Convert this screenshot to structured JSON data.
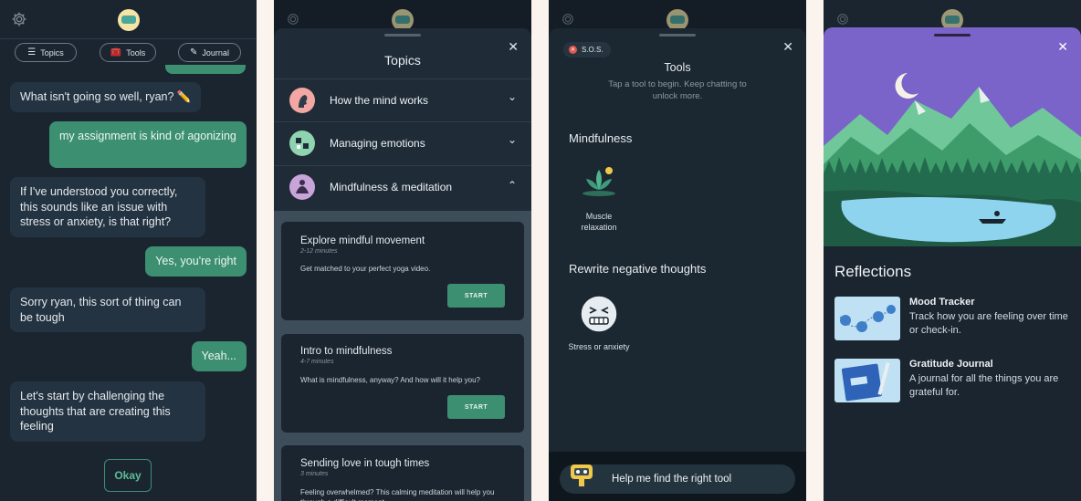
{
  "screen1": {
    "chips": [
      {
        "icon": "list-icon",
        "label": "Topics"
      },
      {
        "icon": "toolbox-icon",
        "label": "Tools"
      },
      {
        "icon": "journal-icon",
        "label": "Journal"
      }
    ],
    "messages": [
      {
        "from": "bot",
        "text": "What isn't going so well, ryan? ✏️"
      },
      {
        "from": "user",
        "text": "my assignment is kind of agonizing"
      },
      {
        "from": "bot",
        "text": "If I've understood you correctly, this sounds like an issue with stress or anxiety, is that right?"
      },
      {
        "from": "user",
        "text": "Yes, you're right"
      },
      {
        "from": "bot",
        "text": "Sorry ryan, this sort of thing can be tough"
      },
      {
        "from": "user",
        "text": "Yeah..."
      },
      {
        "from": "bot",
        "text": "Let's start by challenging the thoughts that are creating this feeling"
      }
    ],
    "reply_button": "Okay"
  },
  "screen2": {
    "title": "Topics",
    "topics": [
      {
        "label": "How the mind works",
        "icon": "head-icon",
        "expanded": false
      },
      {
        "label": "Managing emotions",
        "icon": "emotions-icon",
        "expanded": false
      },
      {
        "label": "Mindfulness & meditation",
        "icon": "meditation-icon",
        "expanded": true
      }
    ],
    "cards": [
      {
        "title": "Explore mindful movement",
        "duration": "2-12 minutes",
        "description": "Get matched to your perfect yoga video.",
        "button": "START"
      },
      {
        "title": "Intro to mindfulness",
        "duration": "4-7 minutes",
        "description": "What is mindfulness, anyway? And how will it help you?",
        "button": "START"
      },
      {
        "title": "Sending love in tough times",
        "duration": "3 minutes",
        "description": "Feeling overwhelmed? This calming meditation will help you through a difficult moment."
      }
    ]
  },
  "screen3": {
    "sos_label": "S.O.S.",
    "title": "Tools",
    "subtitle": "Tap a tool to begin. Keep chatting to unlock more.",
    "sections": [
      {
        "title": "Mindfulness",
        "tools": [
          {
            "label": "Muscle relaxation",
            "icon": "lotus-icon"
          }
        ]
      },
      {
        "title": "Rewrite negative thoughts",
        "tools": [
          {
            "label": "Stress or anxiety",
            "icon": "stressed-face-icon"
          }
        ]
      }
    ],
    "help_button": "Help me find the right tool"
  },
  "screen4": {
    "title": "Reflections",
    "items": [
      {
        "name": "Mood Tracker",
        "description": "Track how you are feeling over time or check-in.",
        "icon": "mood-tracker-thumbnail"
      },
      {
        "name": "Gratitude Journal",
        "description": "A journal for all the things you are grateful for.",
        "icon": "gratitude-journal-thumbnail"
      }
    ]
  },
  "colors": {
    "accent_green": "#3d8f72",
    "bubble_bot": "#243341",
    "background": "#1a2530",
    "sky_purple": "#7a63c9"
  }
}
